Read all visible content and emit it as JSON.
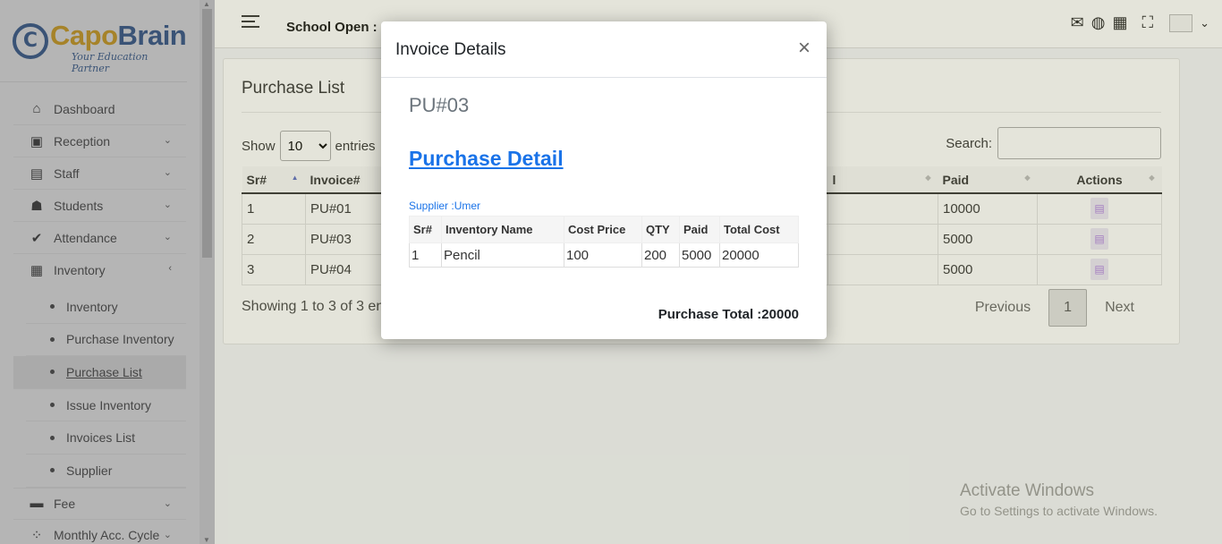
{
  "logo": {
    "mark": "C",
    "brand_a": "Capo",
    "brand_b": "Brain",
    "tagline": "Your Education Partner"
  },
  "sidebar": {
    "items": [
      {
        "label": "Dashboard",
        "icon": "home-icon"
      },
      {
        "label": "Reception",
        "icon": "reception-icon"
      },
      {
        "label": "Staff",
        "icon": "staff-icon"
      },
      {
        "label": "Students",
        "icon": "students-icon"
      },
      {
        "label": "Attendance",
        "icon": "check-icon"
      },
      {
        "label": "Inventory",
        "icon": "clipboard-icon"
      }
    ],
    "sub_items": [
      "Inventory",
      "Purchase Inventory",
      "Purchase List",
      "Issue Inventory",
      "Invoices List",
      "Supplier"
    ],
    "bottom_items": [
      {
        "label": "Fee",
        "icon": "money-icon"
      },
      {
        "label": "Monthly Acc. Cycle",
        "icon": "cycle-icon"
      }
    ]
  },
  "topbar": {
    "school_label": "School Open :"
  },
  "page": {
    "title": "Purchase List",
    "show_label": "Show",
    "entries_value": "10",
    "entries_label": "entries",
    "search_label": "Search:",
    "columns": [
      "Sr#",
      "Invoice#",
      "l",
      "Paid",
      "Actions"
    ],
    "rows": [
      {
        "sr": "1",
        "invoice": "PU#01",
        "paid": "10000"
      },
      {
        "sr": "2",
        "invoice": "PU#03",
        "paid": "5000"
      },
      {
        "sr": "3",
        "invoice": "PU#04",
        "paid": "5000"
      }
    ],
    "info": "Showing 1 to 3 of 3 en",
    "pager": {
      "prev": "Previous",
      "page": "1",
      "next": "Next"
    }
  },
  "modal": {
    "title": "Invoice Details",
    "close": "×",
    "code": "PU#03",
    "link": "Purchase Detail",
    "supplier": "Supplier :Umer",
    "columns": [
      "Sr#",
      "Inventory Name",
      "Cost Price",
      "QTY",
      "Paid",
      "Total Cost"
    ],
    "rows": [
      [
        "1",
        "Pencil",
        "100",
        "200",
        "5000",
        "20000"
      ]
    ],
    "total": "Purchase Total :20000"
  },
  "watermark": {
    "line1": "Activate Windows",
    "line2": "Go to Settings to activate Windows."
  },
  "colors": {
    "brand_blue": "#1f4e8c",
    "brand_gold": "#e3a400",
    "link_blue": "#1a73e8"
  }
}
